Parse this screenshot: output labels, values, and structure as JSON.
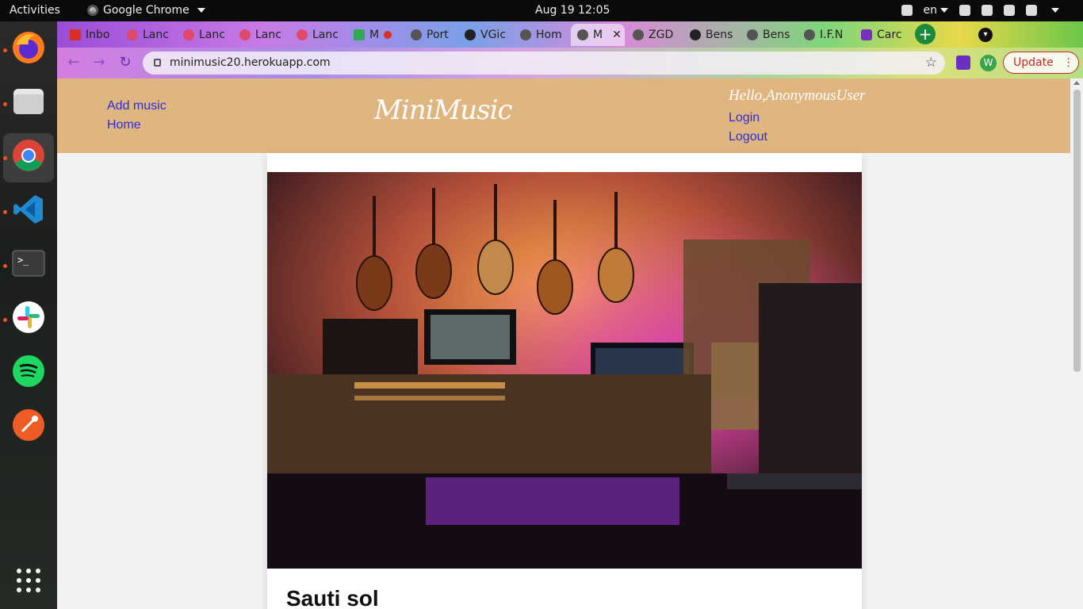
{
  "system": {
    "activities": "Activities",
    "app_name": "Google Chrome",
    "clock": "Aug 19  12:05",
    "lang": "en"
  },
  "tabs": [
    {
      "label": "Inbo",
      "icon": "gmail-icon"
    },
    {
      "label": "Lanc",
      "icon": "lancer-icon"
    },
    {
      "label": "Lanc",
      "icon": "lancer-icon"
    },
    {
      "label": "Lanc",
      "icon": "lancer-icon"
    },
    {
      "label": "Lanc",
      "icon": "lancer-icon"
    },
    {
      "label": "M",
      "icon": "drive-icon"
    },
    {
      "label": "Port",
      "icon": "globe-icon"
    },
    {
      "label": "VGic",
      "icon": "github-icon"
    },
    {
      "label": "Hom",
      "icon": "globe-icon"
    },
    {
      "label": "M",
      "icon": "globe-icon",
      "active": true
    },
    {
      "label": "ZGD",
      "icon": "globe-icon"
    },
    {
      "label": "Bens",
      "icon": "github-icon"
    },
    {
      "label": "Bens",
      "icon": "globe-icon"
    },
    {
      "label": "I.F.N",
      "icon": "globe-icon"
    },
    {
      "label": "Carc",
      "icon": "bootstrap-icon"
    }
  ],
  "browser": {
    "url": "minimusic20.herokuapp.com",
    "update_label": "Update",
    "profile_initial": "W"
  },
  "site": {
    "nav_left": {
      "add_music": "Add music",
      "home": "Home"
    },
    "brand": "MiniMusic",
    "greeting": "Hello,AnonymousUser",
    "nav_right": {
      "login": "Login",
      "logout": "Logout"
    },
    "card_title": "Sauti sol"
  },
  "colors": {
    "header_bg": "#dfb580",
    "link": "#2d2de0",
    "update_red": "#c62828"
  }
}
